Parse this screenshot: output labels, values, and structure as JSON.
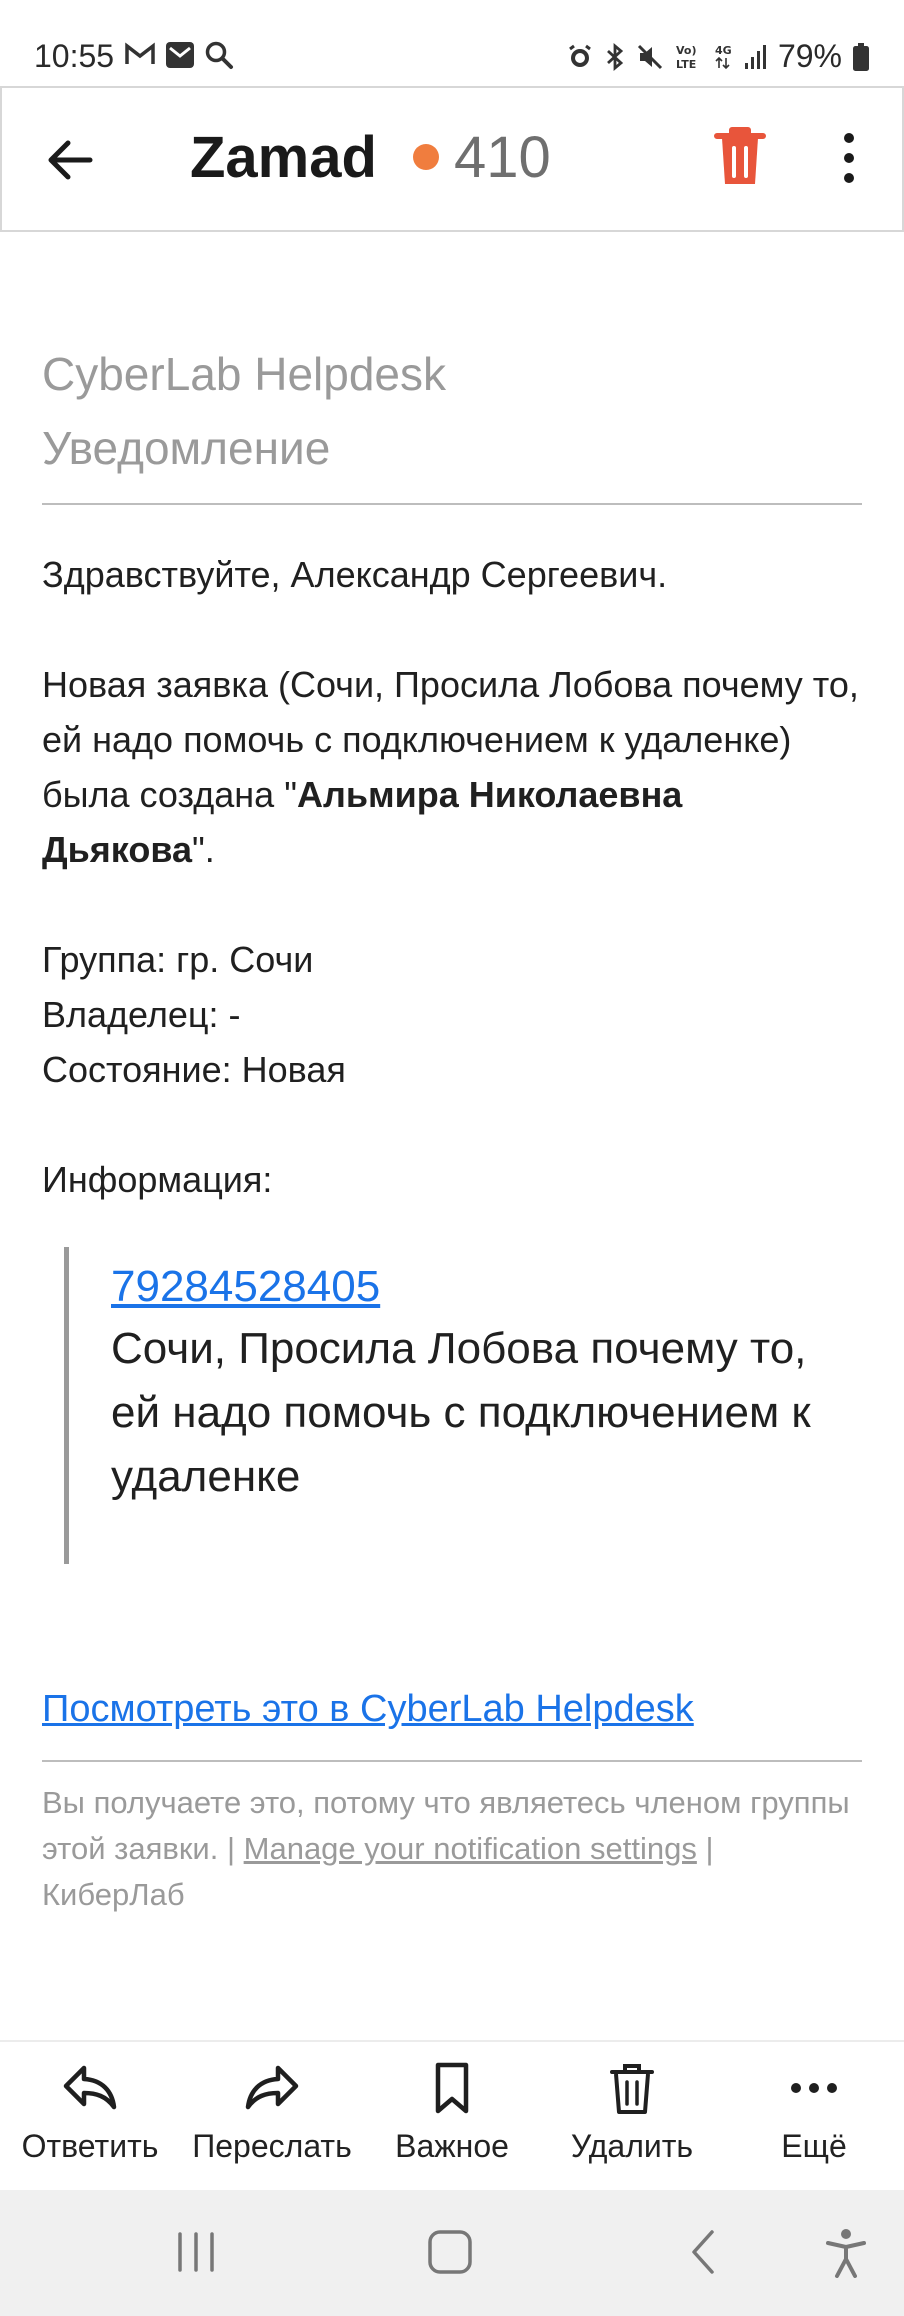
{
  "status_bar": {
    "time": "10:55",
    "battery": "79%",
    "left_icons": [
      "gmail-icon",
      "mail-icon",
      "search-icon"
    ],
    "right_icons": [
      "alarm-icon",
      "bluetooth-icon",
      "mute-icon",
      "volte-icon",
      "4g-icon",
      "signal-icon",
      "battery-icon"
    ]
  },
  "appbar": {
    "title": "Zamad",
    "unread_count": "410",
    "accent": "#f07d3e"
  },
  "email": {
    "header_line1": "CyberLab Helpdesk",
    "header_line2": "Уведомление",
    "greeting": "Здравствуйте, Александр Сергеевич.",
    "created_prefix": "Новая заявка (Сочи, Просила Лобова почему то, ей надо помочь с подключением к удаленке) была создана \"",
    "creator": "Альмира Николаевна Дьякова",
    "created_suffix": "\".",
    "group": "Группа: гр. Сочи",
    "owner": "Владелец: -",
    "state": "Состояние: Новая",
    "info_label": "Информация:",
    "phone": "79284528405",
    "quote_text": "Сочи, Просила Лобова почему то, ей надо помочь с подключением к удаленке",
    "view_link": "Посмотреть это в CyberLab Helpdesk",
    "footer_prefix": "Вы получаете это, потому что являетесь членом группы этой заявки. | ",
    "footer_link": "Manage your notification settings",
    "footer_suffix": " | КиберЛаб"
  },
  "actions": [
    {
      "label": "Ответить",
      "icon": "reply-icon"
    },
    {
      "label": "Переслать",
      "icon": "forward-icon"
    },
    {
      "label": "Важное",
      "icon": "bookmark-icon"
    },
    {
      "label": "Удалить",
      "icon": "trash-icon"
    },
    {
      "label": "Ещё",
      "icon": "more-horizontal-icon"
    }
  ],
  "colors": {
    "link": "#1a73e8",
    "delete_icon": "#e8553b",
    "muted_text": "#9a9a9a"
  }
}
